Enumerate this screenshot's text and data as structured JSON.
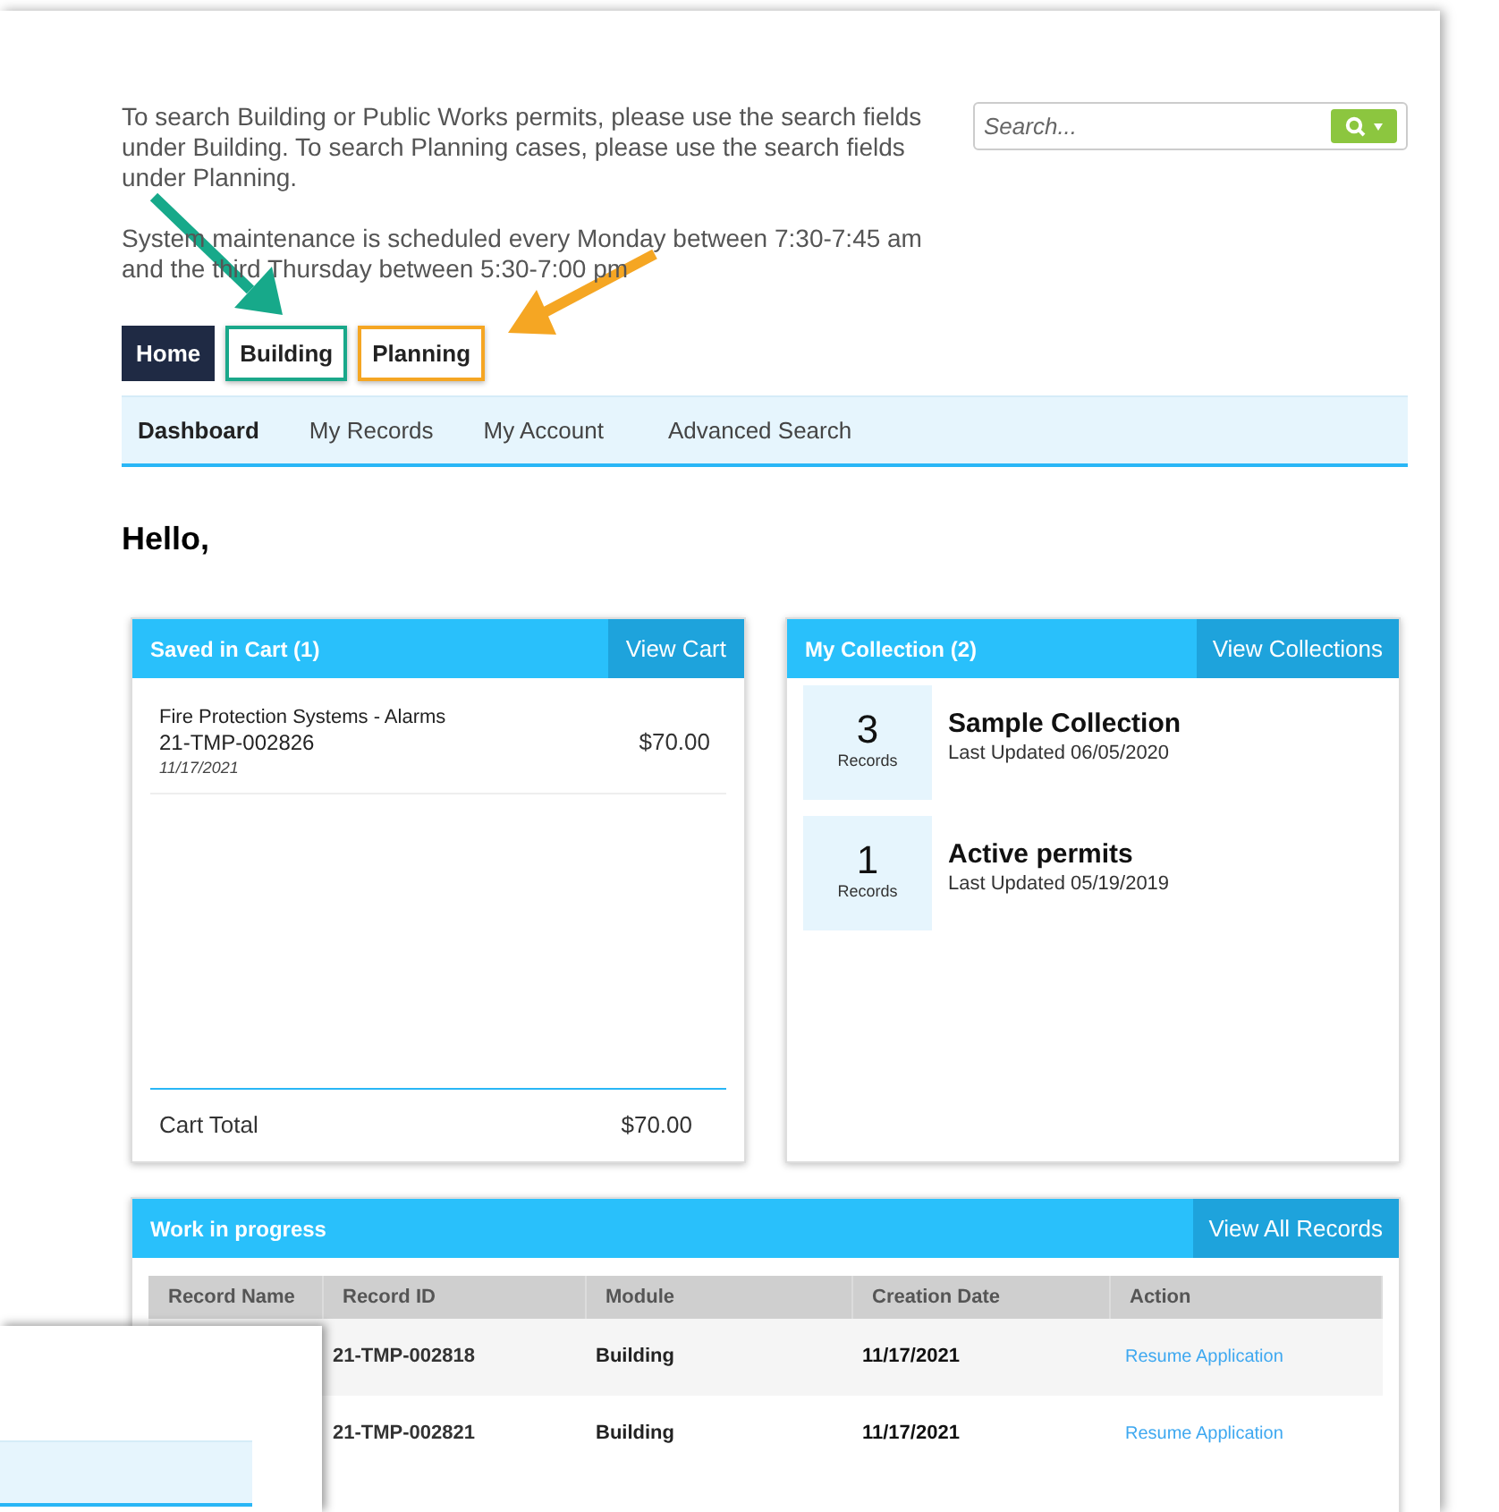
{
  "intro": "To search Building or Public Works permits, please use the search fields under Building. To search Planning cases, please use the search fields under Planning.",
  "maintenance": "System maintenance is scheduled every Monday between 7:30-7:45 am and the third Thursday between 5:30-7:00 pm",
  "search": {
    "placeholder": "Search..."
  },
  "tabs": [
    {
      "label": "Home",
      "selected": true
    },
    {
      "label": "Building",
      "selected": false,
      "color": "#1aa88a"
    },
    {
      "label": "Planning",
      "selected": false,
      "color": "#f5a623"
    }
  ],
  "subnav": [
    {
      "label": "Dashboard",
      "selected": true
    },
    {
      "label": "My Records",
      "selected": false
    },
    {
      "label": "My Account",
      "selected": false
    },
    {
      "label": "Advanced Search",
      "selected": false
    }
  ],
  "greeting": "Hello,",
  "cart": {
    "title": "Saved in Cart (1)",
    "action": "View Cart",
    "items": [
      {
        "name": "Fire Protection Systems - Alarms",
        "id": "21-TMP-002826",
        "date": "11/17/2021",
        "price": "$70.00"
      }
    ],
    "total_label": "Cart Total",
    "total": "$70.00"
  },
  "collection": {
    "title": "My Collection (2)",
    "action": "View Collections",
    "items": [
      {
        "count": "3",
        "unit": "Records",
        "name": "Sample Collection",
        "updated": "Last Updated 06/05/2020"
      },
      {
        "count": "1",
        "unit": "Records",
        "name": "Active permits",
        "updated": "Last Updated 05/19/2019"
      }
    ]
  },
  "work": {
    "title": "Work in progress",
    "action": "View All Records",
    "columns": [
      "Record Name",
      "Record ID",
      "Module",
      "Creation Date",
      "Action"
    ],
    "rows": [
      {
        "record_id": "21-TMP-002818",
        "module": "Building",
        "date": "11/17/2021",
        "action": "Resume Application"
      },
      {
        "record_id": "21-TMP-002821",
        "module": "Building",
        "date": "11/17/2021",
        "action": "Resume Application"
      }
    ]
  }
}
